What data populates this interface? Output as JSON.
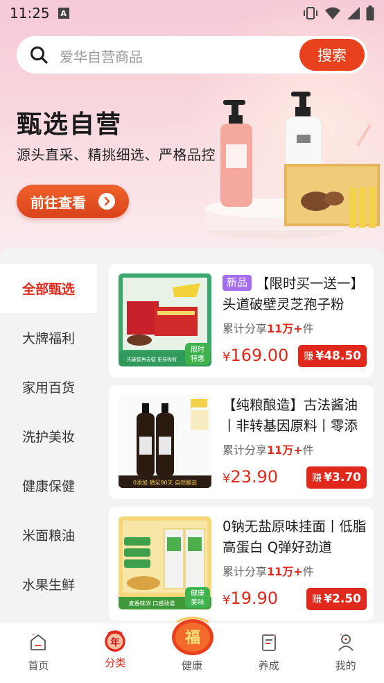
{
  "status_bar": {
    "time": "11:25",
    "notification_letter": "A"
  },
  "search": {
    "placeholder": "爱华自营商品",
    "button_label": "搜索"
  },
  "hero": {
    "title": "甄选自营",
    "subtitle": "源头直采、精挑细选、严格品控",
    "button_label": "前往查看"
  },
  "categories": [
    {
      "label": "全部甄选",
      "active": true
    },
    {
      "label": "大牌福利",
      "active": false
    },
    {
      "label": "家用百货",
      "active": false
    },
    {
      "label": "洗护美妆",
      "active": false
    },
    {
      "label": "健康保健",
      "active": false
    },
    {
      "label": "米面粮油",
      "active": false
    },
    {
      "label": "水果生鲜",
      "active": false
    }
  ],
  "products": [
    {
      "tag": "新品",
      "title": "【限时买一送一】头道破壁灵芝孢子粉",
      "share_prefix": "累计分享",
      "share_count": "11万+",
      "share_suffix": "件",
      "price_symbol": "¥",
      "price": "169.00",
      "earn_label": "赚",
      "earn_amount": "¥48.50",
      "image_badge": "限时特惠",
      "image_caption": "先破壁再去壁 更易吸收"
    },
    {
      "tag": "",
      "title": "【纯粮酿造】古法酱油丨非转基因原料丨零添加",
      "share_prefix": "累计分享",
      "share_count": "11万+",
      "share_suffix": "件",
      "price_symbol": "¥",
      "price": "23.90",
      "earn_label": "赚",
      "earn_amount": "¥3.70",
      "image_badge": "",
      "image_caption": "0添加  晒足90天  自然酿造"
    },
    {
      "tag": "",
      "title": "0钠无盐原味挂面丨低脂高蛋白 Q弹好劲道",
      "share_prefix": "累计分享",
      "share_count": "11万+",
      "share_suffix": "件",
      "price_symbol": "¥",
      "price": "19.90",
      "earn_label": "赚",
      "earn_amount": "¥2.50",
      "image_badge": "健康美味",
      "image_caption": "麦香味浓  口感劲道"
    }
  ],
  "bottom_nav": [
    {
      "label": "首页",
      "icon": "home-icon",
      "active": false
    },
    {
      "label": "分类",
      "icon": "category-icon",
      "active": true
    },
    {
      "label": "健康",
      "icon": "fu-badge-icon",
      "active": false
    },
    {
      "label": "养成",
      "icon": "notebook-icon",
      "active": false
    },
    {
      "label": "我的",
      "icon": "profile-icon",
      "active": false
    }
  ],
  "fu_badge_text": "福",
  "colors": {
    "accent": "#e0291c",
    "search_button": "#e8411e",
    "hero_button": "#e4501f",
    "new_tag": "#a36df0"
  }
}
